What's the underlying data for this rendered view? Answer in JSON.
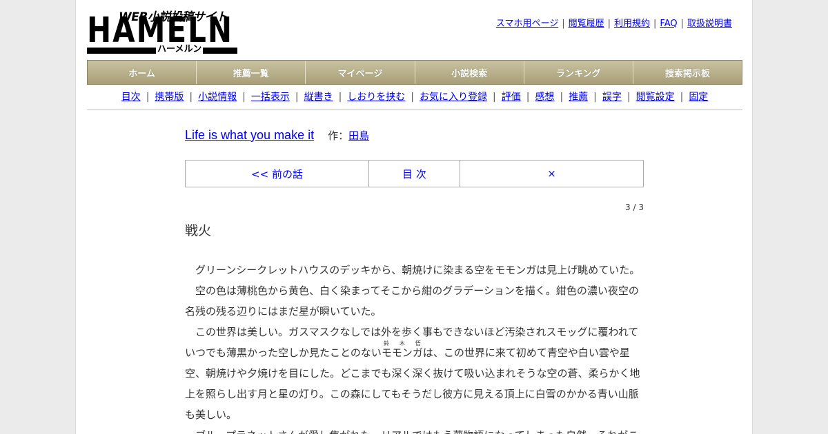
{
  "logo": {
    "wordmark": "HAMELN",
    "tagline": "WEB小説投稿サイト",
    "kana": "ハーメルン"
  },
  "top_links": [
    "スマホ用ページ",
    "閲覧履歴",
    "利用規約",
    "FAQ",
    "取扱説明書"
  ],
  "main_nav": [
    "ホーム",
    "推薦一覧",
    "マイページ",
    "小説検索",
    "ランキング",
    "捜索掲示板"
  ],
  "sub_nav": [
    "目次",
    "携帯版",
    "小説情報",
    "一括表示",
    "縦書き",
    "しおりを挟む",
    "お気に入り登録",
    "評価",
    "感想",
    "推薦",
    "誤字",
    "閲覧設定",
    "固定"
  ],
  "story": {
    "title": "Life is what you make it",
    "author_prefix": "作：",
    "author": "田島"
  },
  "chapter_nav": {
    "prev": "<< 前の話",
    "toc": "目 次",
    "next": "×"
  },
  "page_counter": "3 / 3",
  "chapter_title": "戦火",
  "body": {
    "p1": "グリーンシークレットハウスのデッキから、朝焼けに染まる空をモモンガは見上げ眺めていた。",
    "p2": "空の色は薄桃色から黄色、白く染まってそこから紺のグラデーションを描く。紺色の濃い夜空の名残の残る辺りにはまだ星が瞬いていた。",
    "p3_a": "この世界は美しい。ガスマスクなしでは外を歩く事もできないほど汚染されスモッグに覆われていつでも薄黒かった空しか見たことのない",
    "p3_ruby_base": "モモンガ",
    "p3_ruby_text": "鈴 木 悟",
    "p3_b": "は、この世界に来て初めて青空や白い雲や星空、朝焼けや夕焼けを目にした。どこまでも深く深く抜けて吸い込まれそうな空の蒼、柔らかく地上を照らし出す月と星の灯り。この森にしてもそうだし彼方に見える頂上に白雪のかかる青い山脈も美しい。",
    "p4": "ブループラネットさんが愛し焦がれた、リアルではもう夢物語になってしまった自然。それがこ"
  }
}
